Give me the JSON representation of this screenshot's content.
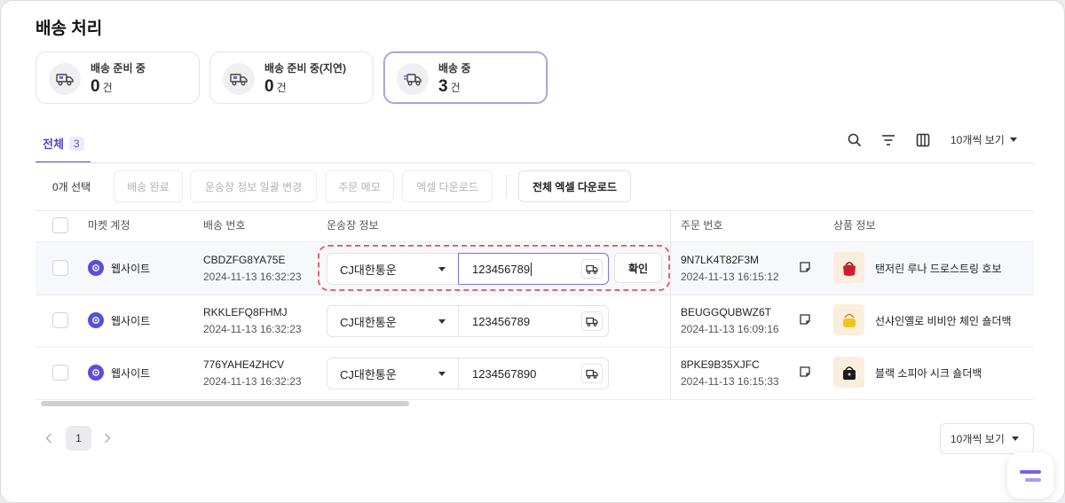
{
  "page": {
    "title": "배송 처리"
  },
  "status_cards": [
    {
      "label": "배송 준비 중",
      "count": "0",
      "unit": "건",
      "icon": "truck-box-icon"
    },
    {
      "label": "배송 준비 중(지연)",
      "count": "0",
      "unit": "건",
      "icon": "truck-box-icon"
    },
    {
      "label": "배송 중",
      "count": "3",
      "unit": "건",
      "icon": "fast-truck-icon",
      "selected": true
    }
  ],
  "tabs": [
    {
      "label": "전체",
      "count": "3",
      "active": true
    }
  ],
  "toolbar": {
    "per_page": "10개씩 보기",
    "icons": [
      "search-icon",
      "filter-icon",
      "columns-icon"
    ]
  },
  "actions": {
    "selected_count": "0개 선택",
    "buttons": [
      {
        "label": "배송 완료",
        "enabled": false
      },
      {
        "label": "운송장 정보 일괄 변경",
        "enabled": false
      },
      {
        "label": "주문 메모",
        "enabled": false
      },
      {
        "label": "엑셀 다운로드",
        "enabled": false
      },
      {
        "label": "전체 엑셀 다운로드",
        "enabled": true
      }
    ]
  },
  "table": {
    "headers": {
      "market": "마켓 계정",
      "shipment": "배송 번호",
      "waybill": "운송장 정보",
      "order": "주문 번호",
      "product": "상품 정보"
    },
    "confirm_label": "확인",
    "rows": [
      {
        "market": "웹사이트",
        "shipment_no": "CBDZFG8YA75E",
        "shipment_date": "2024-11-13 16:32:23",
        "carrier": "CJ대한통운",
        "tracking": "123456789",
        "order_no": "9N7LK4T82F3M",
        "order_date": "2024-11-13 16:15:12",
        "product": "탠저린 루나 드로스트링 호보",
        "thumb_color": "#c8202a"
      },
      {
        "market": "웹사이트",
        "shipment_no": "RKKLEFQ8FHMJ",
        "shipment_date": "2024-11-13 16:32:23",
        "carrier": "CJ대한통운",
        "tracking": "123456789",
        "order_no": "BEUGGQUBWZ6T",
        "order_date": "2024-11-13 16:09:16",
        "product": "선샤인옐로 비비안 체인 숄더백",
        "thumb_color": "#f2c321"
      },
      {
        "market": "웹사이트",
        "shipment_no": "776YAHE4ZHCV",
        "shipment_date": "2024-11-13 16:32:23",
        "carrier": "CJ대한통운",
        "tracking": "1234567890",
        "order_no": "8PKE9B35XJFC",
        "order_date": "2024-11-13 16:15:33",
        "product": "블랙 소피아 시크 숄더백",
        "thumb_color": "#1a1a1a"
      }
    ]
  },
  "pagination": {
    "current": "1",
    "per_page": "10개씩 보기"
  },
  "colors": {
    "accent": "#5b4fd6",
    "highlight_dash": "#e0666b"
  }
}
